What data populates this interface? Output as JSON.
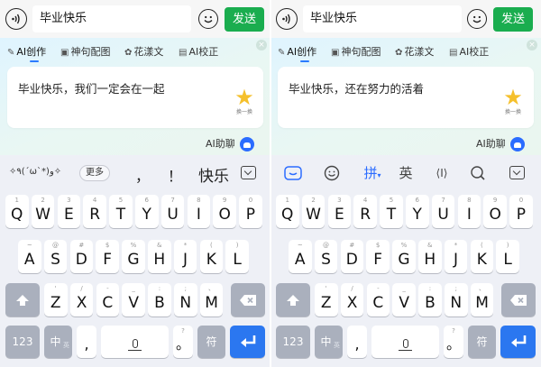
{
  "panels": [
    {
      "chat": {
        "input_value": "毕业快乐",
        "send_label": "发送"
      },
      "ai_tabs": [
        "AI创作",
        "神句配图",
        "花漾文",
        "AI校正"
      ],
      "ai_suggestion": "毕业快乐，我们一定会在一起",
      "refresh_label": "换一换",
      "ai_assistant_label": "AI助聊",
      "toolbar": {
        "kaomoji": "✧٩(ˊωˋ*)و✧",
        "more_label": "更多",
        "candidates": [
          "，",
          "！",
          "快乐"
        ]
      }
    },
    {
      "chat": {
        "input_value": "毕业快乐",
        "send_label": "发送"
      },
      "ai_tabs": [
        "AI创作",
        "神句配图",
        "花漾文",
        "AI校正"
      ],
      "ai_suggestion": "毕业快乐，还在努力的活着",
      "refresh_label": "换一换",
      "ai_assistant_label": "AI助聊",
      "toolbar": {
        "pinyin_label": "拼",
        "english_label": "英",
        "cursor_label": "⟨I⟩"
      }
    }
  ],
  "keyboard": {
    "row1": [
      {
        "k": "Q",
        "s": "1"
      },
      {
        "k": "W",
        "s": "2"
      },
      {
        "k": "E",
        "s": "3"
      },
      {
        "k": "R",
        "s": "4"
      },
      {
        "k": "T",
        "s": "5"
      },
      {
        "k": "Y",
        "s": "6"
      },
      {
        "k": "U",
        "s": "7"
      },
      {
        "k": "I",
        "s": "8"
      },
      {
        "k": "O",
        "s": "9"
      },
      {
        "k": "P",
        "s": "0"
      }
    ],
    "row2": [
      {
        "k": "A",
        "s": "~"
      },
      {
        "k": "S",
        "s": "@"
      },
      {
        "k": "D",
        "s": "#"
      },
      {
        "k": "F",
        "s": "$"
      },
      {
        "k": "G",
        "s": "%"
      },
      {
        "k": "H",
        "s": "&"
      },
      {
        "k": "J",
        "s": "*"
      },
      {
        "k": "K",
        "s": "("
      },
      {
        "k": "L",
        "s": ")"
      }
    ],
    "row3": [
      {
        "k": "Z",
        "s": "'"
      },
      {
        "k": "X",
        "s": "/"
      },
      {
        "k": "C",
        "s": "-"
      },
      {
        "k": "V",
        "s": "_"
      },
      {
        "k": "B",
        "s": ":"
      },
      {
        "k": "N",
        "s": ";"
      },
      {
        "k": "M",
        "s": "、"
      }
    ],
    "numbers_label": "123",
    "chinese_label": "中",
    "chinese_sub": "英",
    "comma_key": ",",
    "period_key": "。",
    "period_sub": "?",
    "symbol_label": "符"
  },
  "colors": {
    "send_green": "#1aad4f",
    "accent_blue": "#2b77f0",
    "function_key_gray": "#aab0bd"
  }
}
